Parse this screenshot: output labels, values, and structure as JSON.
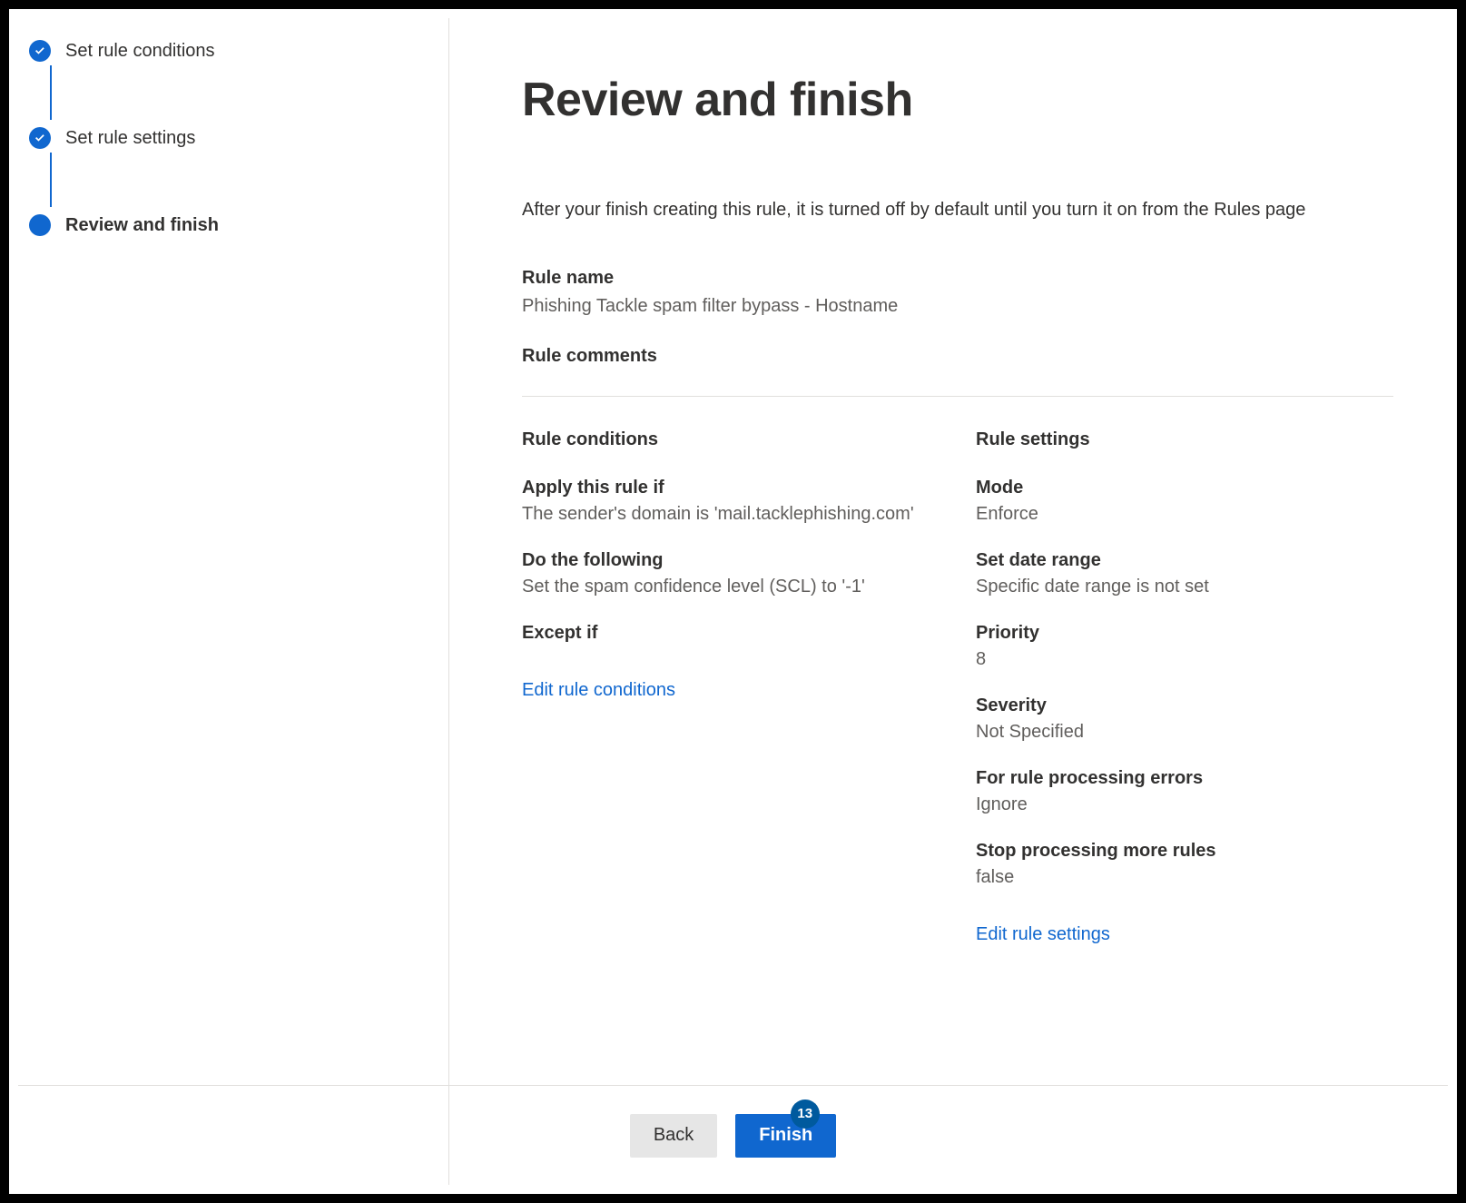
{
  "steps": [
    {
      "label": "Set rule conditions",
      "state": "done"
    },
    {
      "label": "Set rule settings",
      "state": "done"
    },
    {
      "label": "Review and finish",
      "state": "current"
    }
  ],
  "page": {
    "title": "Review and finish",
    "intro": "After your finish creating this rule, it is turned off by default until you turn it on from the Rules page"
  },
  "rule": {
    "name_label": "Rule name",
    "name_value": "Phishing Tackle spam filter bypass - Hostname",
    "comments_label": "Rule comments",
    "comments_value": ""
  },
  "conditions": {
    "heading": "Rule conditions",
    "apply_label": "Apply this rule if",
    "apply_value": "The sender's domain is 'mail.tacklephishing.com'",
    "do_label": "Do the following",
    "do_value": "Set the spam confidence level (SCL) to '-1'",
    "except_label": "Except if",
    "except_value": "",
    "edit_link": "Edit rule conditions"
  },
  "settings": {
    "heading": "Rule settings",
    "mode_label": "Mode",
    "mode_value": "Enforce",
    "daterange_label": "Set date range",
    "daterange_value": "Specific date range is not set",
    "priority_label": "Priority",
    "priority_value": "8",
    "severity_label": "Severity",
    "severity_value": "Not Specified",
    "errors_label": "For rule processing errors",
    "errors_value": "Ignore",
    "stop_label": "Stop processing more rules",
    "stop_value": "false",
    "edit_link": "Edit rule settings"
  },
  "footer": {
    "back": "Back",
    "finish": "Finish",
    "badge": "13"
  }
}
